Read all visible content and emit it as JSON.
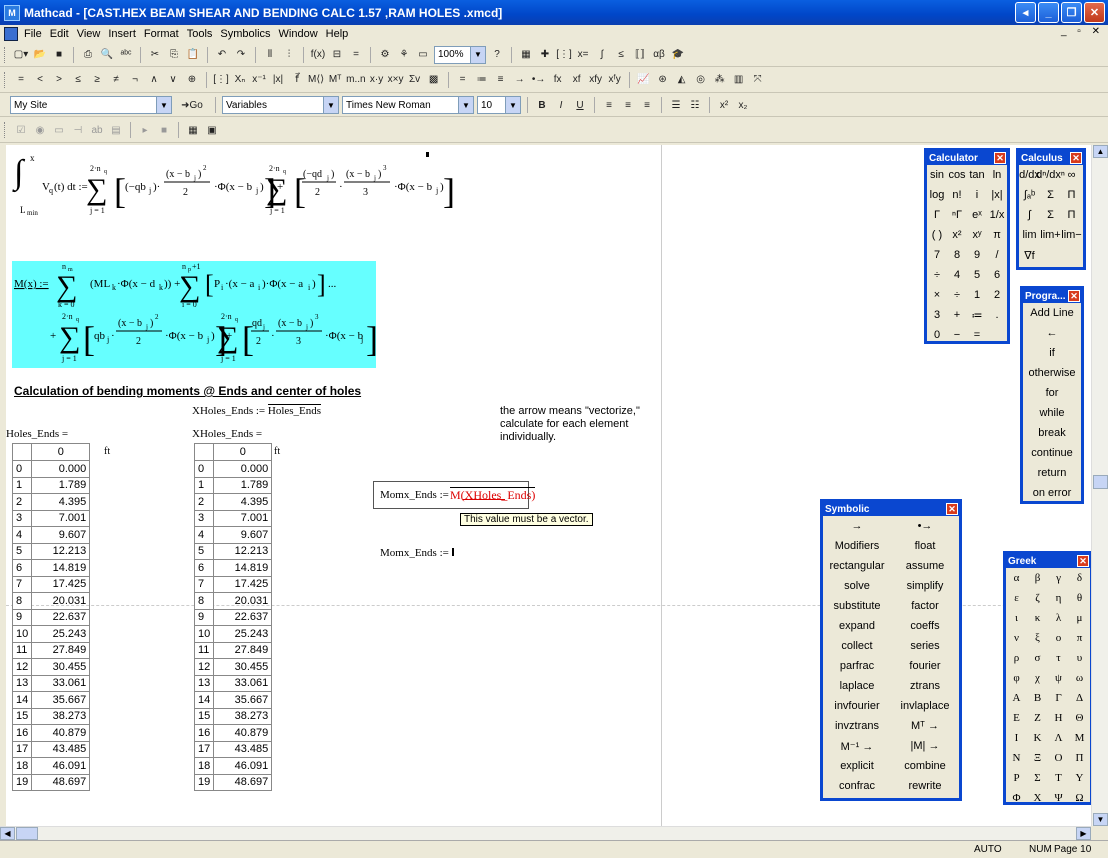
{
  "window": {
    "title": "Mathcad - [CAST.HEX BEAM SHEAR AND BENDING CALC 1.57 ,RAM HOLES  .xmcd]"
  },
  "menu": [
    "File",
    "Edit",
    "View",
    "Insert",
    "Format",
    "Tools",
    "Symbolics",
    "Window",
    "Help"
  ],
  "toolbar": {
    "zoom": "100%",
    "site": "My Site",
    "go": "Go",
    "style": "Variables",
    "font": "Times New Roman",
    "size": "10",
    "bold": "B",
    "italic": "I",
    "underline": "U"
  },
  "worksheet": {
    "integral": "∫Lmin..x Vq(t) dt := Σj=1..2·nq [(−qbj)·(x − bj)²/2 ·Φ(x − bj)] + Σj=1..2·nq [(−qdj/2)·(x − bj)³/3 ·Φ(x − bj)]",
    "moment_line1": "M(x) := Σk=0..nm (MLk·Φ(x − dk)) + Σi=0..np+1 [Pi·(x − ai)·Φ(x − ai)] ...",
    "moment_line2": "+ Σj=1..2·nq [qbj·(x − bj)²/2 ·Φ(x − bj)] + Σj=1..2·nq [qdj/2·(x − bj)³/3 ·Φ(x − bj)]",
    "heading": "Calculation of bending moments @ Ends and center of holes",
    "vectorize_lhs": "XHoles_Ends",
    "vectorize_rhs": "Holes_Ends",
    "note": "the arrow means \"vectorize,\" calculate for each element individually.",
    "holes_label": "Holes_Ends =",
    "unit": "ft",
    "x_label": "XHoles_Ends =",
    "col_header": "0",
    "rows": [
      "0",
      "1",
      "2",
      "3",
      "4",
      "5",
      "6",
      "7",
      "8",
      "9",
      "10",
      "11",
      "12",
      "13",
      "14",
      "15",
      "16",
      "17",
      "18",
      "19"
    ],
    "values": [
      "0.000",
      "1.789",
      "4.395",
      "7.001",
      "9.607",
      "12.213",
      "14.819",
      "17.425",
      "20.031",
      "22.637",
      "25.243",
      "27.849",
      "30.455",
      "33.061",
      "35.667",
      "38.273",
      "40.879",
      "43.485",
      "46.091",
      "48.697"
    ],
    "momx_lhs": "Momx_Ends :=",
    "momx_rhs": "M(XHoles_Ends)",
    "tooltip": "This value must be a vector.",
    "momx2": "Momx_Ends := "
  },
  "palettes": {
    "calculator": {
      "title": "Calculator",
      "keys": [
        "sin",
        "cos",
        "tan",
        "ln",
        "log",
        "n!",
        "i",
        "|x|",
        "Γ",
        "ⁿΓ",
        "eˣ",
        "1/x",
        "( )",
        "x²",
        "xʸ",
        "π",
        "7",
        "8",
        "9",
        "/",
        "÷",
        "4",
        "5",
        "6",
        "×",
        "÷",
        "1",
        "2",
        "3",
        "+",
        "≔",
        ".",
        "0",
        "−",
        "="
      ]
    },
    "calculus": {
      "title": "Calculus",
      "keys": [
        "d/dx",
        "dⁿ/dxⁿ",
        "∞",
        "∫ₐᵇ",
        "Σ",
        "Π",
        "∫",
        "Σ",
        "Π",
        "lim",
        "lim+",
        "lim−",
        "∇f"
      ]
    },
    "programming": {
      "title": "Progra...",
      "items": [
        "Add Line",
        "←",
        "if",
        "otherwise",
        "for",
        "while",
        "break",
        "continue",
        "return",
        "on error"
      ]
    },
    "symbolic": {
      "title": "Symbolic",
      "items": [
        "→",
        "•→",
        "Modifiers",
        "float",
        "rectangular",
        "assume",
        "solve",
        "simplify",
        "substitute",
        "factor",
        "expand",
        "coeffs",
        "collect",
        "series",
        "parfrac",
        "fourier",
        "laplace",
        "ztrans",
        "invfourier",
        "invlaplace",
        "invztrans",
        "Mᵀ →",
        "M⁻¹ →",
        "|M| →",
        "explicit",
        "combine",
        "confrac",
        "rewrite"
      ]
    },
    "greek": {
      "title": "Greek",
      "keys": [
        "α",
        "β",
        "γ",
        "δ",
        "ε",
        "ζ",
        "η",
        "θ",
        "ι",
        "κ",
        "λ",
        "μ",
        "ν",
        "ξ",
        "ο",
        "π",
        "ρ",
        "σ",
        "τ",
        "υ",
        "φ",
        "χ",
        "ψ",
        "ω",
        "Α",
        "Β",
        "Γ",
        "Δ",
        "Ε",
        "Ζ",
        "Η",
        "Θ",
        "Ι",
        "Κ",
        "Λ",
        "Μ",
        "Ν",
        "Ξ",
        "Ο",
        "Π",
        "Ρ",
        "Σ",
        "Τ",
        "Υ",
        "Φ",
        "Χ",
        "Ψ",
        "Ω"
      ]
    }
  },
  "status": {
    "mode": "AUTO",
    "num": "NUM",
    "page": "Page 10"
  }
}
